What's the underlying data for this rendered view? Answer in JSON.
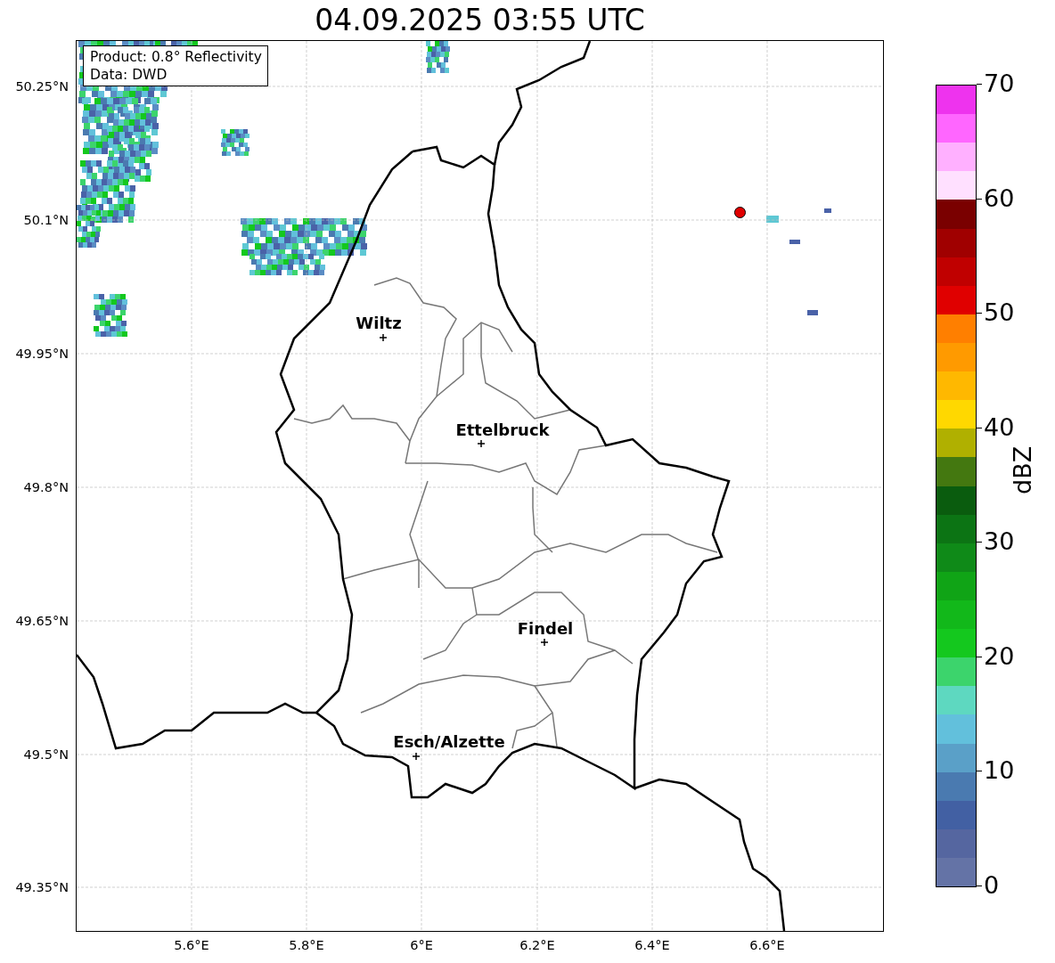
{
  "title": "04.09.2025 03:55 UTC",
  "info_box": {
    "lines": [
      "Product: 0.8° Reflectivity",
      "Data: DWD"
    ]
  },
  "map": {
    "y_ticks": [
      "50.25°N",
      "50.1°N",
      "49.95°N",
      "49.8°N",
      "49.65°N",
      "49.5°N",
      "49.35°N"
    ],
    "x_ticks": [
      "5.6°E",
      "5.8°E",
      "6°E",
      "6.2°E",
      "6.4°E",
      "6.6°E"
    ],
    "cities": [
      {
        "name": "Wiltz"
      },
      {
        "name": "Ettelbruck"
      },
      {
        "name": "Findel"
      },
      {
        "name": "Esch/Alzette"
      }
    ],
    "radar_marker": {
      "color": "#e00000"
    }
  },
  "colorbar": {
    "label": "dBZ",
    "ticks": [
      "70",
      "60",
      "50",
      "40",
      "30",
      "20",
      "10",
      "0"
    ],
    "segments": [
      {
        "color": "#ee33ee"
      },
      {
        "color": "#ff66ff"
      },
      {
        "color": "#ffb0ff"
      },
      {
        "color": "#ffe0ff"
      },
      {
        "color": "#7a0000"
      },
      {
        "color": "#a00000"
      },
      {
        "color": "#c00000"
      },
      {
        "color": "#e00000"
      },
      {
        "color": "#ff7f00"
      },
      {
        "color": "#ff9a00"
      },
      {
        "color": "#ffb800"
      },
      {
        "color": "#ffd800"
      },
      {
        "color": "#b0b000"
      },
      {
        "color": "#447810"
      },
      {
        "color": "#0a5c0e"
      },
      {
        "color": "#0c7414"
      },
      {
        "color": "#0f8a18"
      },
      {
        "color": "#10a416"
      },
      {
        "color": "#12b81a"
      },
      {
        "color": "#14c81e"
      },
      {
        "color": "#3cd46c"
      },
      {
        "color": "#5ed8c0"
      },
      {
        "color": "#62c0dc"
      },
      {
        "color": "#5aa0c8"
      },
      {
        "color": "#4a7ab0"
      },
      {
        "color": "#4260a3"
      },
      {
        "color": "#5566a0"
      },
      {
        "color": "#6473a6"
      }
    ]
  }
}
